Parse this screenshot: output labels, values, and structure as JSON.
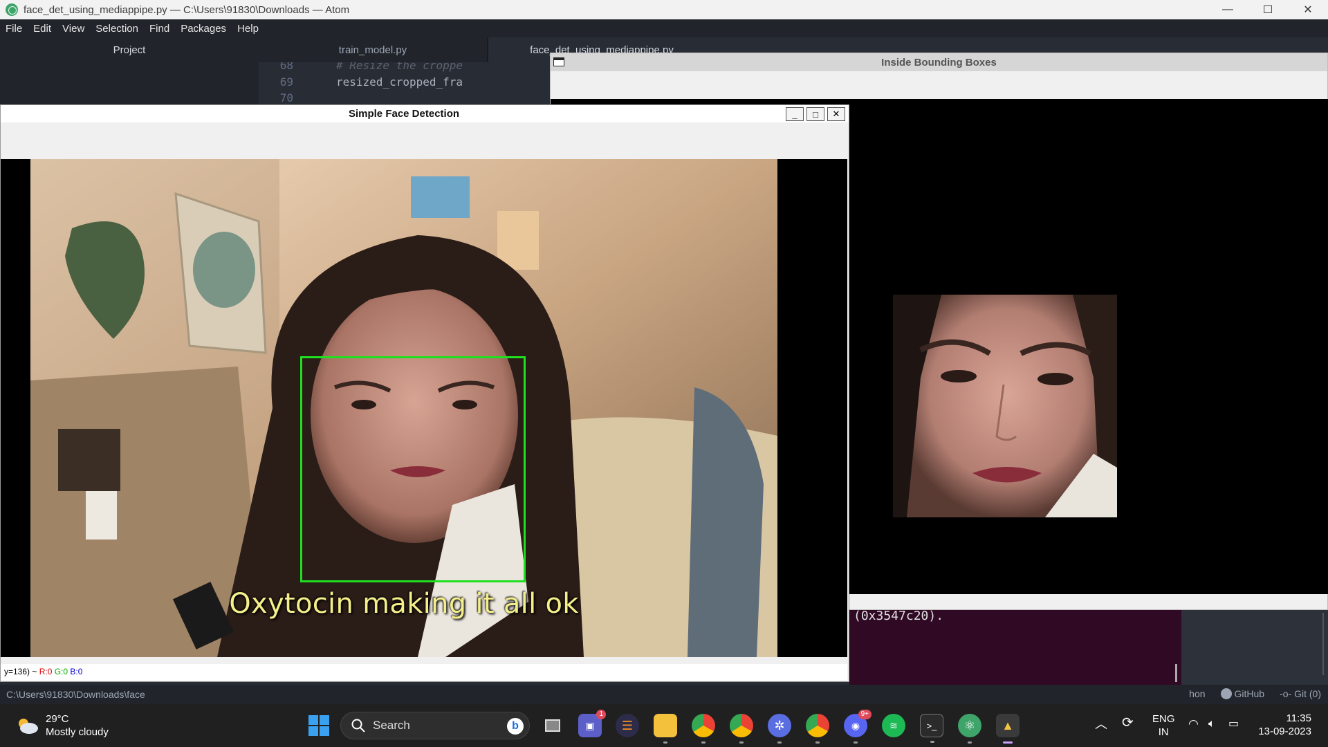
{
  "atom": {
    "window_title": "face_det_using_mediappipe.py — C:\\Users\\91830\\Downloads — Atom",
    "menu": [
      "File",
      "Edit",
      "View",
      "Selection",
      "Find",
      "Packages",
      "Help"
    ],
    "tree_header": "Project",
    "tabs": [
      {
        "label": "train_model.py",
        "active": false
      },
      {
        "label": "face_det_using_mediappipe.py",
        "active": true
      }
    ],
    "editor_lines": [
      {
        "num": "68",
        "text": "# Resize the croppe",
        "comment": true
      },
      {
        "num": "69",
        "text": "resized_cropped_fra",
        "comment": false
      },
      {
        "num": "70",
        "text": "",
        "comment": false
      }
    ],
    "status_path": "C:\\Users\\91830\\Downloads\\face",
    "status_right": [
      "hon",
      "GitHub",
      "Git (0)"
    ]
  },
  "terminal": {
    "text": "(0x3547c20)."
  },
  "bbox_window": {
    "title": "Inside Bounding Boxes"
  },
  "sfd_window": {
    "title": "Simple Face Detection",
    "buttons": {
      "minimize": "_",
      "maximize": "□",
      "close": "✕"
    },
    "subtitle": "Oxytocin making it all ok",
    "status": {
      "prefix": "y=136) ~ ",
      "r": "R:0",
      "g": "G:0",
      "b": "B:0"
    }
  },
  "taskbar": {
    "weather_temp": "29°C",
    "weather_desc": "Mostly cloudy",
    "search_label": "Search",
    "teams_badge": "1",
    "discord_badge": "9+",
    "lang_top": "ENG",
    "lang_bottom": "IN",
    "time": "11:35",
    "date": "13-09-2023"
  },
  "colors": {
    "face_box": "#1fe01f",
    "subtitle": "#f4ef8a",
    "terminal_bg": "#300a24"
  }
}
